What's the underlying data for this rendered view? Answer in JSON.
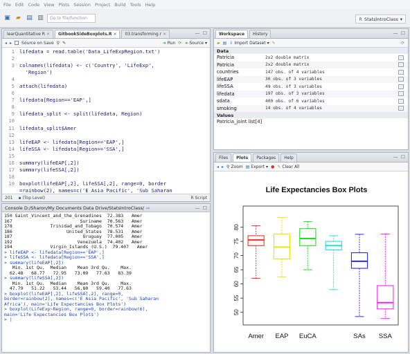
{
  "menu": [
    "File",
    "Edit",
    "Code",
    "View",
    "Plots",
    "Session",
    "Project",
    "Build",
    "Tools",
    "Help"
  ],
  "toolbar": {
    "goto_placeholder": "Go to file/function",
    "project_label": "StatsIntroClass"
  },
  "editor": {
    "tabs": [
      {
        "label": "learQuantitative R",
        "active": false
      },
      {
        "label": "GitbookSideBoxplots.R",
        "active": true
      },
      {
        "label": "03.transforming.r",
        "active": false
      }
    ],
    "toolbar": {
      "source_on_save": "Source on Save",
      "run": "Run",
      "source": "Source"
    },
    "lines": [
      {
        "n": "1",
        "t": "lifedata = read.table('Data_LifeExpRegion.txt')"
      },
      {
        "n": "2",
        "t": ""
      },
      {
        "n": "3",
        "t": "colnames(lifedata) <- c('Country', 'LifeExp',"
      },
      {
        "n": "",
        "t": "  'Region')"
      },
      {
        "n": "4",
        "t": ""
      },
      {
        "n": "5",
        "t": "attach(lifedata)"
      },
      {
        "n": "6",
        "t": ""
      },
      {
        "n": "7",
        "t": "lifedata[Region=='EAP',]"
      },
      {
        "n": "8",
        "t": ""
      },
      {
        "n": "9",
        "t": "lifedata_split <- split(lifedata, Region)"
      },
      {
        "n": "10",
        "t": ""
      },
      {
        "n": "11",
        "t": "lifedata_split$Amer"
      },
      {
        "n": "12",
        "t": ""
      },
      {
        "n": "13",
        "t": "lifeEAP <- lifedata[Region=='EAP',]"
      },
      {
        "n": "14",
        "t": "lifeSSA <- lifedata[Region=='SSA',]"
      },
      {
        "n": "15",
        "t": ""
      },
      {
        "n": "16",
        "t": "summary(lifeEAP[,2])"
      },
      {
        "n": "17",
        "t": "summary(lifeSSA[,2])"
      },
      {
        "n": "18",
        "t": ""
      },
      {
        "n": "19",
        "t": "boxplot(lifeEAP[,2], lifeSSA[,2], range=0, border"
      },
      {
        "n": "",
        "t": "=rainbow(2), names=c('E Asia Pacific', 'Sub Saharan"
      },
      {
        "n": "",
        "t": "Africa'), main='Life Expectancies Box Plots')"
      },
      {
        "n": "20",
        "t": ""
      },
      {
        "n": "21",
        "t": ""
      }
    ],
    "status_pos": "201",
    "status_scope": "(Top Level)",
    "status_type": "R Script"
  },
  "console": {
    "title": "Console D:/Sharon/My Documents Data Drive/StatsIntroClass/",
    "lines": [
      {
        "k": "out",
        "t": "150 Saint_Vincent_and_the_Grenadines  72.383   Amer"
      },
      {
        "k": "out",
        "t": "167                         Suriname  70.563   Amer"
      },
      {
        "k": "out",
        "t": "178              Trinidad_and_Tobago  70.574   Amer"
      },
      {
        "k": "out",
        "t": "186                    United_States  78.531   Amer"
      },
      {
        "k": "out",
        "t": "187                          Uruguay  77.005   Amer"
      },
      {
        "k": "out",
        "t": "192                        Venezuela  74.402   Amer"
      },
      {
        "k": "out",
        "t": "194              Virgin_Islands_(U.S.)  79.407   Amer"
      },
      {
        "k": "cmd",
        "t": "> lifeEAP <- lifedata[Region=='EAP',]"
      },
      {
        "k": "cmd",
        "t": "> lifeSSA <- lifedata[Region=='SSA',]"
      },
      {
        "k": "cmd",
        "t": "> summary(lifeEAP[,2])"
      },
      {
        "k": "out",
        "t": "   Min. 1st Qu.  Median    Mean 3rd Qu.    Max."
      },
      {
        "k": "out",
        "t": "  62.48   68.77   72.95   73.09   77.63   83.39"
      },
      {
        "k": "cmd",
        "t": "> summary(lifeSSA[,2])"
      },
      {
        "k": "out",
        "t": "   Min. 1st Qu.  Median    Mean 3rd Qu.    Max."
      },
      {
        "k": "out",
        "t": "  47.79   51.22   53.44   56.80   59.40   77.63"
      },
      {
        "k": "cmd",
        "t": "> boxplot(lifeEAP[,2], lifeSSA[,2], range=0,"
      },
      {
        "k": "cmd",
        "t": "border=rainbow(2), names=c('E Asia Pacific', 'Sub Saharan"
      },
      {
        "k": "cmd",
        "t": "Africa'), main='Life Expectancies Box Plots')"
      },
      {
        "k": "cmd",
        "t": "> boxplot(LifeExp~Region, range=0, border=rainbow(6),"
      },
      {
        "k": "cmd",
        "t": "main='Life Expectancies Box Plots')"
      },
      {
        "k": "cmd",
        "t": "> |"
      }
    ]
  },
  "workspace": {
    "tabs": [
      {
        "label": "Workspace",
        "active": true
      },
      {
        "label": "History",
        "active": false
      }
    ],
    "import_label": "Import Dataset",
    "data_header": "Data",
    "rows": [
      {
        "n": "Patricia",
        "v": "2x2 double matrix"
      },
      {
        "n": "Patricia",
        "v": "2x2 double matrix"
      },
      {
        "n": "countries",
        "v": "147 obs. of 4 variables"
      },
      {
        "n": "lifeEAP",
        "v": "30 obs. of 3 variables"
      },
      {
        "n": "lifeSSA",
        "v": "49 obs. of 3 variables"
      },
      {
        "n": "lifedata",
        "v": "197 obs. of 3 variables"
      },
      {
        "n": "sdata",
        "v": "400 obs. of 6 variables"
      },
      {
        "n": "smoking",
        "v": "14 obs. of 4 variables"
      }
    ],
    "values_header": "Values",
    "values_row": "Patricia_joint list[4]"
  },
  "plots": {
    "tabs": [
      {
        "label": "Files",
        "active": false
      },
      {
        "label": "Plots",
        "active": true
      },
      {
        "label": "Packages",
        "active": false
      },
      {
        "label": "Help",
        "active": false
      }
    ],
    "toolbar": {
      "zoom": "Zoom",
      "export": "Export",
      "clear": "Clear All"
    }
  },
  "chart_data": {
    "type": "box",
    "title": "Life Expectancies Box Plots",
    "xlabel": "",
    "ylabel": "",
    "ylim": [
      47,
      86
    ],
    "yticks": [
      50,
      55,
      60,
      65,
      70,
      75,
      80
    ],
    "categories": [
      "Amer",
      "EAP",
      "EuCA",
      "",
      "SAs",
      "SSA"
    ],
    "boxes": [
      {
        "name": "Amer",
        "min": 62.0,
        "q1": 73.5,
        "median": 75.5,
        "q3": 77.0,
        "max": 80.5,
        "color": "#ff2a2a"
      },
      {
        "name": "EAP",
        "min": 62.5,
        "q1": 68.8,
        "median": 73.0,
        "q3": 77.6,
        "max": 83.4,
        "color": "#e6e600"
      },
      {
        "name": "EuCA",
        "min": 65.0,
        "q1": 73.5,
        "median": 76.0,
        "q3": 79.5,
        "max": 82.0,
        "color": "#22dd22"
      },
      {
        "name": "",
        "min": 58.0,
        "q1": 72.0,
        "median": 73.5,
        "q3": 75.0,
        "max": 77.0,
        "color": "#22dddd"
      },
      {
        "name": "SAs",
        "min": 48.5,
        "q1": 65.5,
        "median": 68.0,
        "q3": 71.0,
        "max": 77.5,
        "color": "#2a2aff"
      },
      {
        "name": "SSA",
        "min": 47.8,
        "q1": 51.2,
        "median": 53.4,
        "q3": 59.4,
        "max": 77.6,
        "color": "#ff22ff"
      }
    ]
  }
}
